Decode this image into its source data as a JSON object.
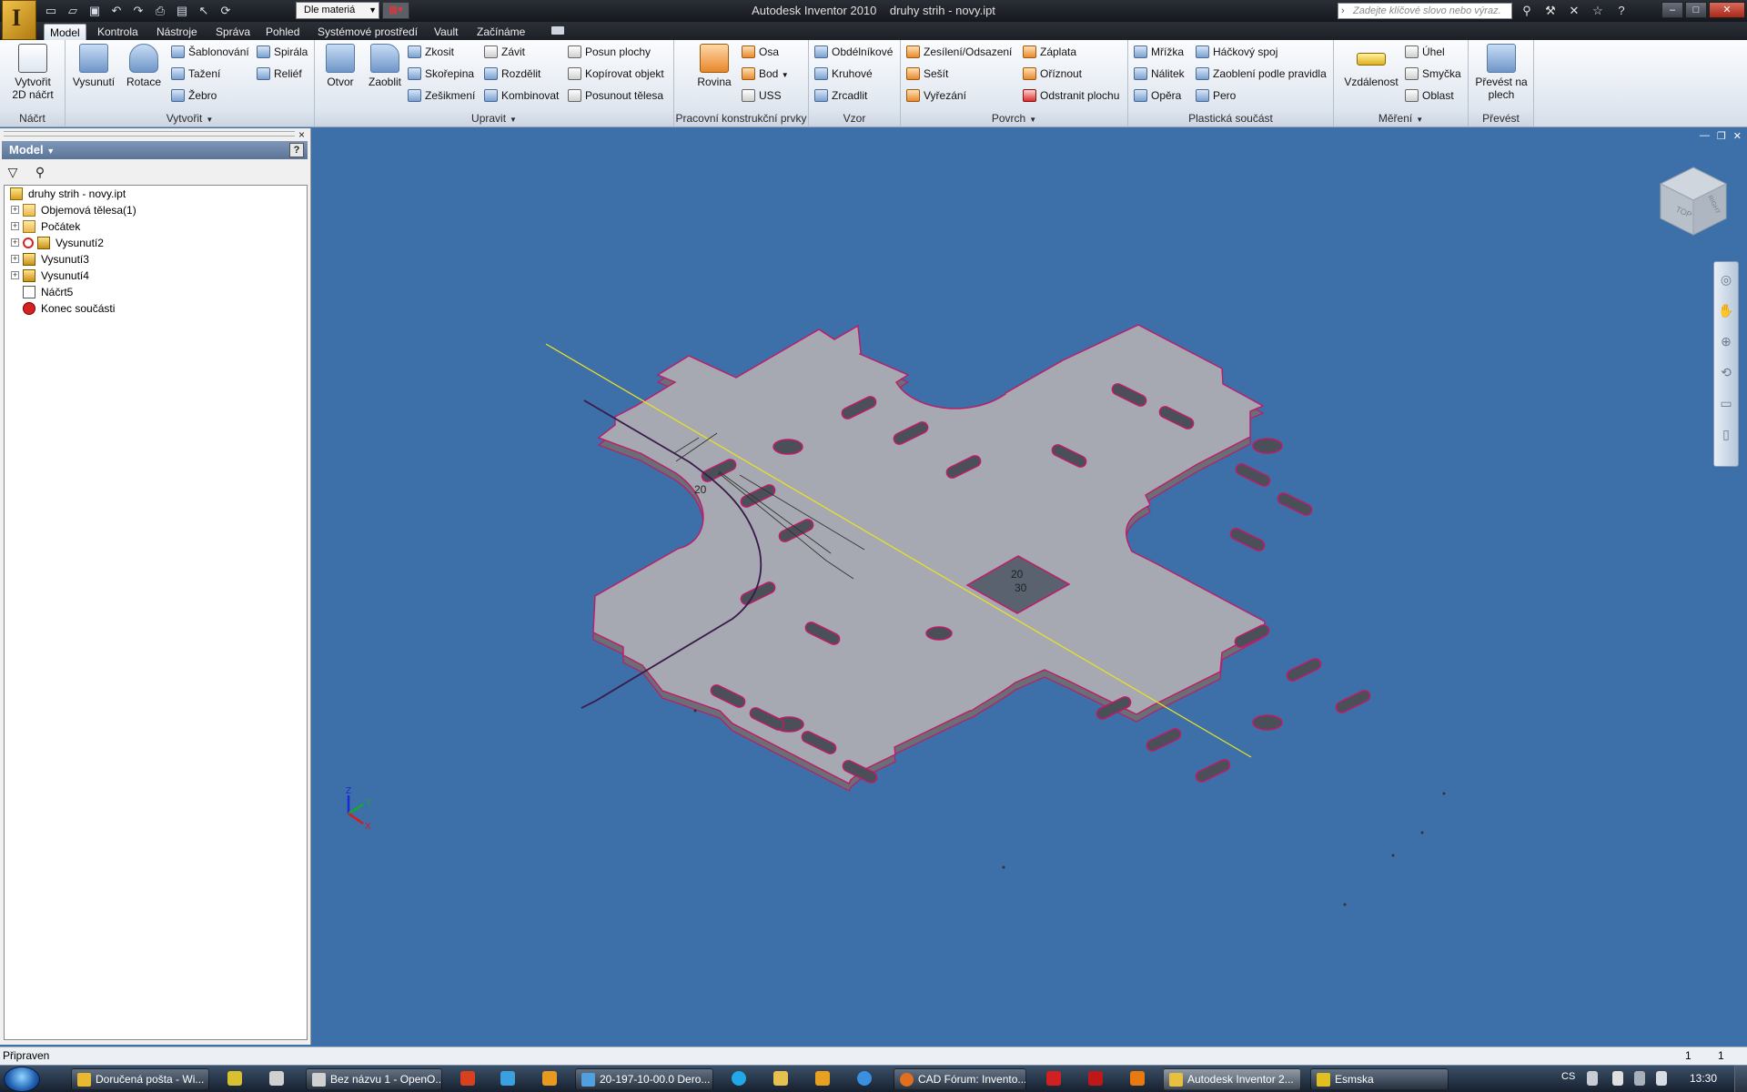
{
  "window": {
    "app_title": "Autodesk Inventor 2010",
    "doc_title": "druhy strih - novy.ipt",
    "logo_letter": "I",
    "material": "Dle materiá",
    "search_placeholder": "Zadejte klíčové slovo nebo výraz.",
    "controls": [
      "_",
      "□",
      "X"
    ]
  },
  "quick_access": [
    "new-icon",
    "open-icon",
    "save-icon",
    "undo-icon",
    "redo-icon",
    "print-icon",
    "properties-icon",
    "select-icon",
    "update-icon"
  ],
  "help_toolbar": [
    "binoculars-icon",
    "tools-icon",
    "x-icon",
    "star-icon",
    "help-icon"
  ],
  "tabs": [
    "Model",
    "Kontrola",
    "Nástroje",
    "Správa",
    "Pohled",
    "Systémové prostředí",
    "Vault",
    "Začínáme"
  ],
  "active_tab": "Model",
  "ribbon": {
    "nacrt": {
      "label": "Náčrt",
      "btn1": "Vytvořit",
      "btn2": "2D náčrt"
    },
    "vytvorit": {
      "label": "Vytvořit",
      "vysunuti": "Vysunutí",
      "rotace": "Rotace",
      "sablonovani": "Šablonování",
      "tazeni": "Tažení",
      "zebro": "Žebro",
      "spirala": "Spirála",
      "relief": "Reliéf"
    },
    "upravit": {
      "label": "Upravit",
      "otvor": "Otvor",
      "zaoblit": "Zaoblit",
      "zkosit": "Zkosit",
      "skorepina": "Skořepina",
      "zesikmeni": "Zešikmení",
      "zavit": "Závit",
      "rozdelit": "Rozdělit",
      "kombinovat": "Kombinovat",
      "posun_plochy": "Posun plochy",
      "kopirovat": "Kopírovat objekt",
      "posunout": "Posunout tělesa"
    },
    "pracovni": {
      "label": "Pracovní konstrukční prvky",
      "rovina": "Rovina",
      "osa": "Osa",
      "bod": "Bod",
      "uss": "USS"
    },
    "vzor": {
      "label": "Vzor",
      "obdelnikove": "Obdélníkové",
      "kruhove": "Kruhové",
      "zrcadlit": "Zrcadlit"
    },
    "povrch": {
      "label": "Povrch",
      "zesileni": "Zesílení/Odsazení",
      "sesit": "Sešít",
      "vyrezani": "Vyřezání",
      "zaplata": "Záplata",
      "oriznout": "Oříznout",
      "odstranit": "Odstranit plochu"
    },
    "plasticka": {
      "label": "Plastická součást",
      "mrizka": "Mřížka",
      "nalitek": "Nálitek",
      "opera": "Opěra",
      "hackovy": "Háčkový spoj",
      "zaobleni": "Zaoblení podle pravidla",
      "pero": "Pero"
    },
    "mereni": {
      "label": "Měření",
      "vzdalenost": "Vzdálenost",
      "uhel": "Úhel",
      "smycka": "Smyčka",
      "oblast": "Oblast"
    },
    "prevest": {
      "label": "Převést",
      "btn1": "Převést na",
      "btn2": "plech"
    }
  },
  "browser": {
    "title": "Model",
    "close": "×",
    "help": "?",
    "tree": [
      {
        "label": "druhy strih - novy.ipt",
        "icon": "part-icon",
        "indent": 0,
        "expander": false
      },
      {
        "label": "Objemová tělesa(1)",
        "icon": "folder-icon",
        "indent": 1,
        "expander": true
      },
      {
        "label": "Počátek",
        "icon": "folder-icon",
        "indent": 1,
        "expander": true
      },
      {
        "label": "Vysunutí2",
        "icon": "extrude-icon",
        "indent": 1,
        "expander": true,
        "marker": "rebuild"
      },
      {
        "label": "Vysunutí3",
        "icon": "extrude-icon",
        "indent": 1,
        "expander": true
      },
      {
        "label": "Vysunutí4",
        "icon": "extrude-icon",
        "indent": 1,
        "expander": true
      },
      {
        "label": "Náčrt5",
        "icon": "sketch-icon",
        "indent": 1,
        "expander": false
      },
      {
        "label": "Konec součásti",
        "icon": "end-of-part-icon",
        "indent": 1,
        "expander": false
      }
    ]
  },
  "viewport": {
    "dimensions": [
      "20",
      "20",
      "30"
    ],
    "viewcube_face": "TOP",
    "viewcube_side": "RIGHT",
    "axes": [
      "Z",
      "Y",
      "X"
    ]
  },
  "status": {
    "text": "Připraven",
    "n1": "1",
    "n2": "1"
  },
  "taskbar": {
    "items": [
      {
        "label": "Doručená pošta - Wi...",
        "color": "#e8b830",
        "active": false
      },
      {
        "label": "Bez názvu 1 - OpenO...",
        "color": "#d0d0d0",
        "active": false
      },
      {
        "label": "20-197-10-00.0 Dero...",
        "color": "#50a0e0",
        "active": false
      },
      {
        "label": "CAD Fórum: Invento...",
        "color": "#e07020",
        "active": false
      },
      {
        "label": "Autodesk Inventor 2...",
        "color": "#e8c040",
        "active": true
      },
      {
        "label": "Esmska",
        "color": "#e0c020",
        "active": false
      }
    ],
    "lang": "CS",
    "clock": "13:30"
  }
}
